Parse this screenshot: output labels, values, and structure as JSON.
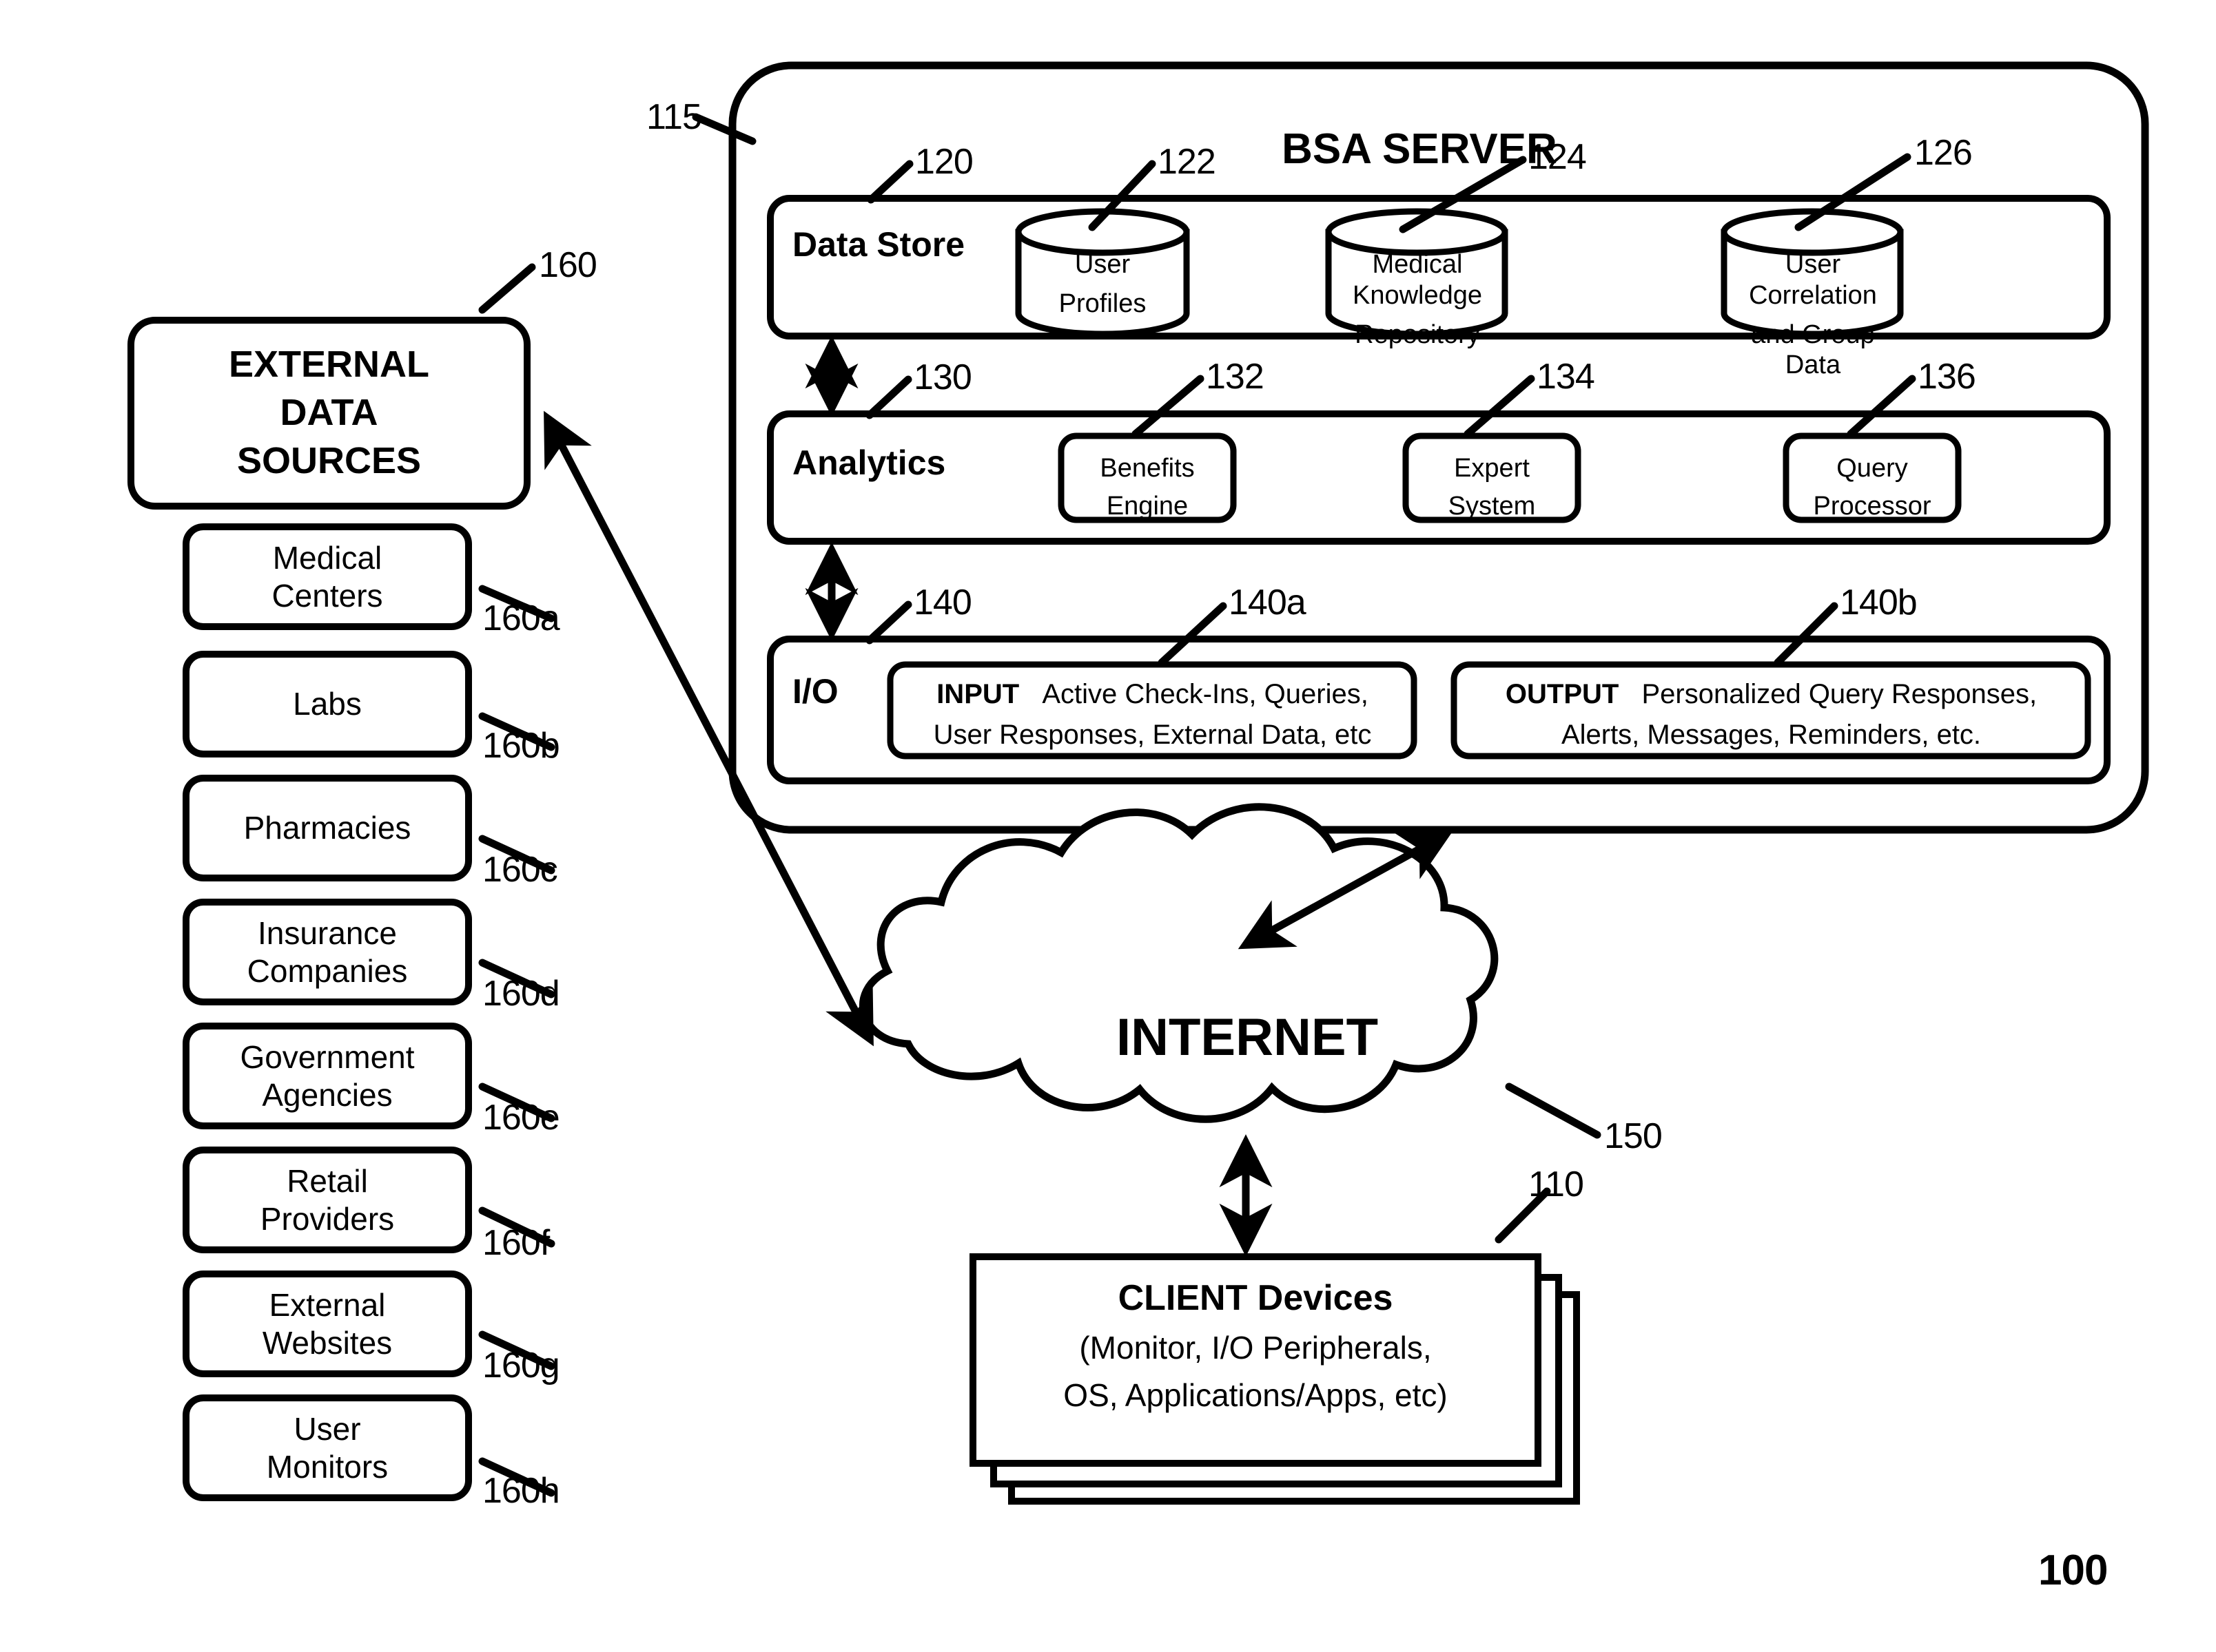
{
  "figure": {
    "number": "100",
    "server": {
      "title": "BSA SERVER",
      "ref": "115",
      "data_store": {
        "label": "Data Store",
        "ref": "120",
        "cylinders": [
          {
            "lines": [
              "User",
              "Profiles"
            ],
            "ref": "122"
          },
          {
            "lines": [
              "Medical Knowledge",
              "Repository"
            ],
            "ref": "124"
          },
          {
            "lines": [
              "User Correlation",
              "and Group Data"
            ],
            "ref": "126"
          }
        ]
      },
      "analytics": {
        "label": "Analytics",
        "ref": "130",
        "modules": [
          {
            "lines": [
              "Benefits",
              "Engine"
            ],
            "ref": "132"
          },
          {
            "lines": [
              "Expert",
              "System"
            ],
            "ref": "134"
          },
          {
            "lines": [
              "Query",
              "Processor"
            ],
            "ref": "136"
          }
        ]
      },
      "io": {
        "label": "I/O",
        "ref": "140",
        "input": {
          "tag": "INPUT",
          "line1": "Active Check-Ins, Queries,",
          "line2": "User Responses, External Data, etc",
          "ref": "140a"
        },
        "output": {
          "tag": "OUTPUT",
          "line1": "Personalized Query Responses,",
          "line2": "Alerts, Messages, Reminders, etc.",
          "ref": "140b"
        }
      }
    },
    "external_data_sources": {
      "title_lines": [
        "EXTERNAL",
        "DATA",
        "SOURCES"
      ],
      "ref": "160",
      "items": [
        {
          "lines": [
            "Medical",
            "Centers"
          ],
          "ref": "160a"
        },
        {
          "lines": [
            "Labs"
          ],
          "ref": "160b"
        },
        {
          "lines": [
            "Pharmacies"
          ],
          "ref": "160c"
        },
        {
          "lines": [
            "Insurance",
            "Companies"
          ],
          "ref": "160d"
        },
        {
          "lines": [
            "Government",
            "Agencies"
          ],
          "ref": "160e"
        },
        {
          "lines": [
            "Retail",
            "Providers"
          ],
          "ref": "160f"
        },
        {
          "lines": [
            "External",
            "Websites"
          ],
          "ref": "160g"
        },
        {
          "lines": [
            "User",
            "Monitors"
          ],
          "ref": "160h"
        }
      ]
    },
    "internet": {
      "label": "INTERNET",
      "ref": "150"
    },
    "client_devices": {
      "title": "CLIENT Devices",
      "line2": "(Monitor, I/O Peripherals,",
      "line3": "OS, Applications/Apps, etc)",
      "ref": "110"
    },
    "colors": {
      "stroke": "#000000",
      "fill": "#ffffff"
    }
  }
}
